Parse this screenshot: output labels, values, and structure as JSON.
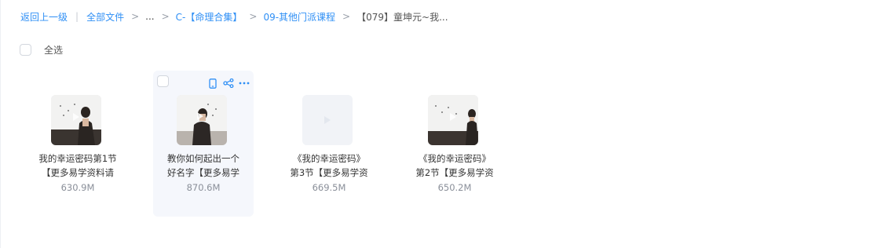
{
  "breadcrumb": {
    "back": "返回上一级",
    "all_files": "全部文件",
    "ellipsis": "...",
    "level1": "C-【命理合集】",
    "level2": "09-其他门派课程",
    "current": "【079】童坤元~我..."
  },
  "select_all": {
    "label": "全选"
  },
  "accent_color": "#2f8ff5",
  "files": [
    {
      "name_line1": "我的幸运密码第1节",
      "name_line2": "【更多易学资料请",
      "size": "630.9M",
      "thumb": "video-lecture-man"
    },
    {
      "name_line1": "教你如何起出一个",
      "name_line2": "好名字【更多易学",
      "size": "870.6M",
      "thumb": "video-lecture-woman"
    },
    {
      "name_line1": "《我的幸运密码》",
      "name_line2": "第3节【更多易学资",
      "size": "669.5M",
      "thumb": "video-placeholder"
    },
    {
      "name_line1": "《我的幸运密码》",
      "name_line2": "第2节【更多易学资",
      "size": "650.2M",
      "thumb": "video-lecture-man-right"
    }
  ],
  "hover_actions": {
    "icons": [
      "phone-icon",
      "share-icon",
      "more-icon"
    ]
  }
}
